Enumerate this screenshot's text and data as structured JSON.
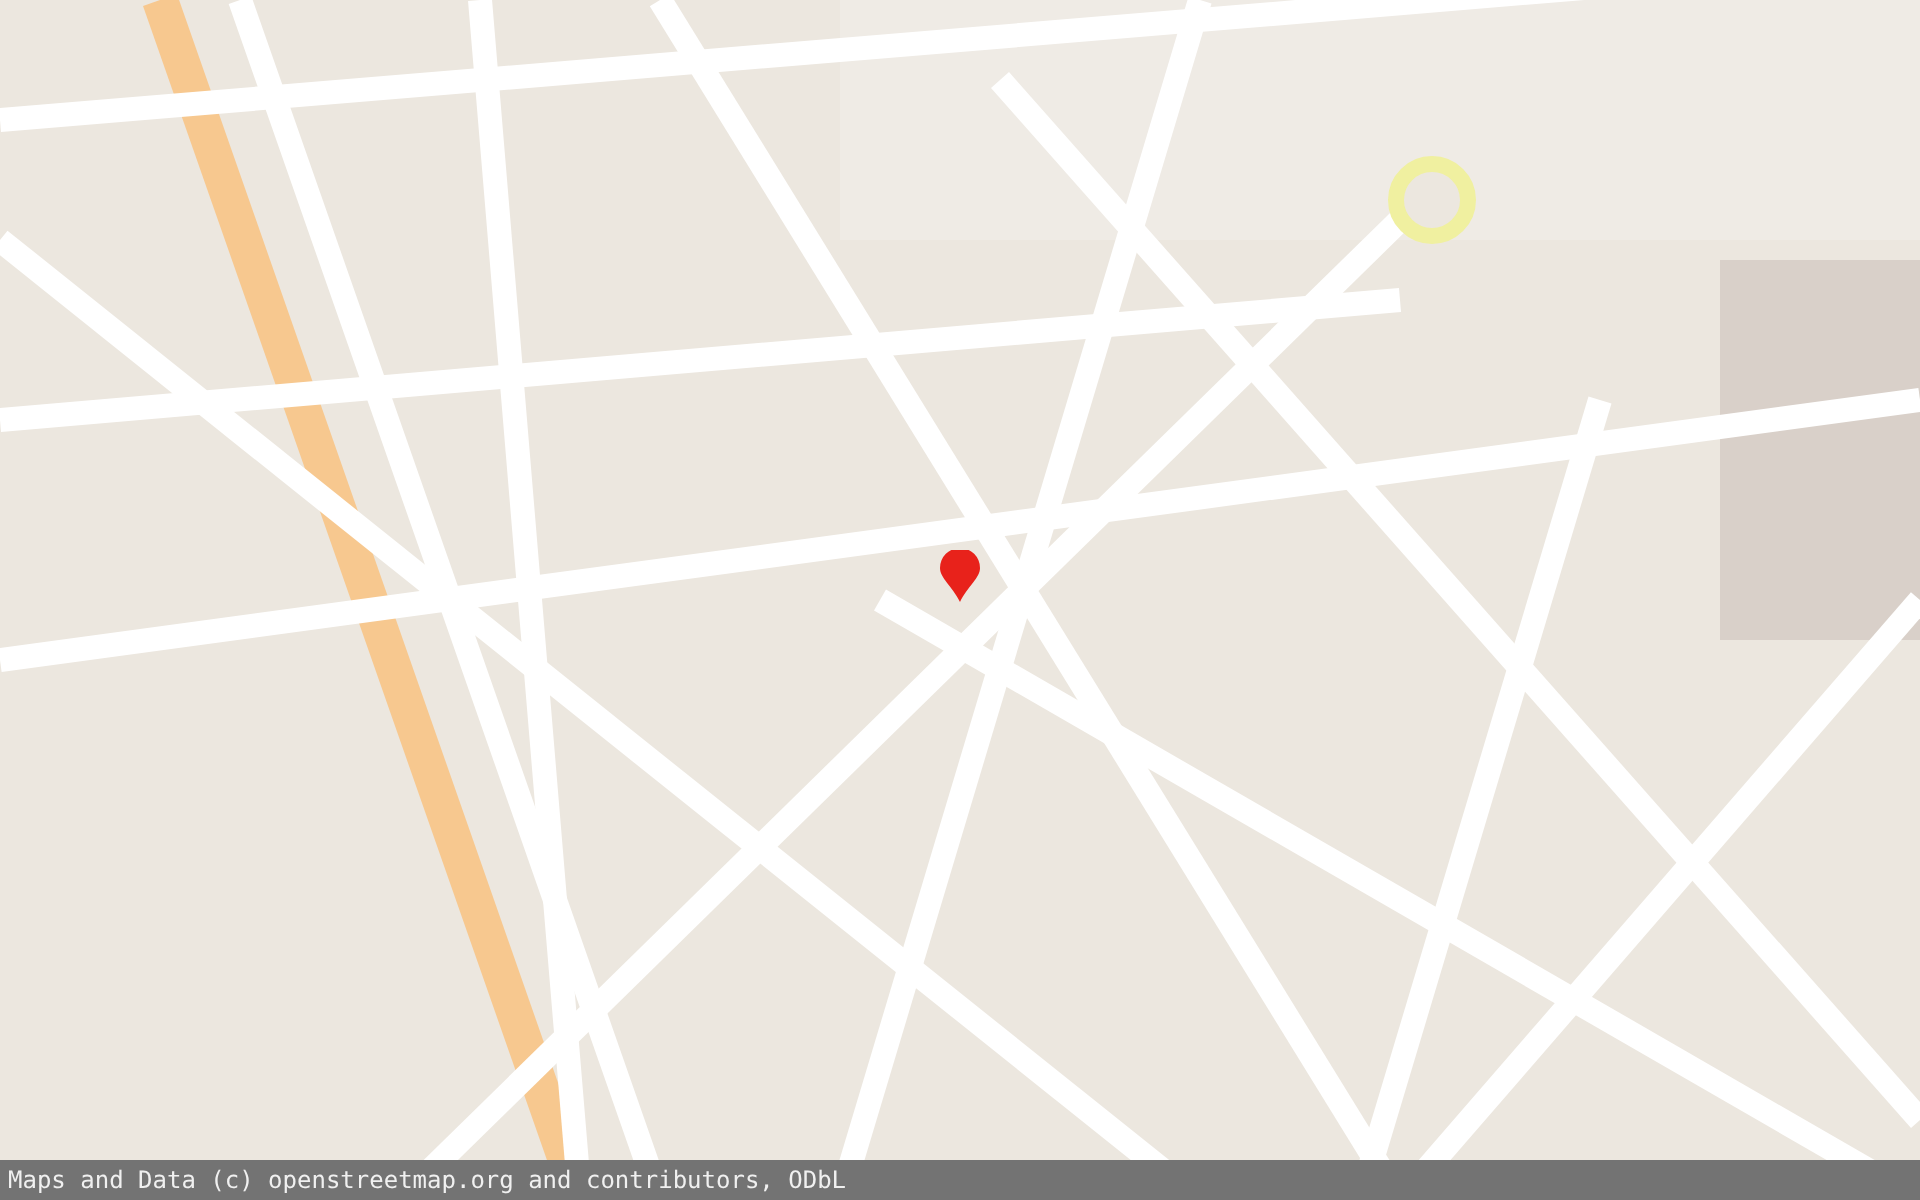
{
  "map": {
    "marker": {
      "color": "#e8221b"
    }
  },
  "attribution": "Maps and Data (c) openstreetmap.org and contributors, ODbL"
}
